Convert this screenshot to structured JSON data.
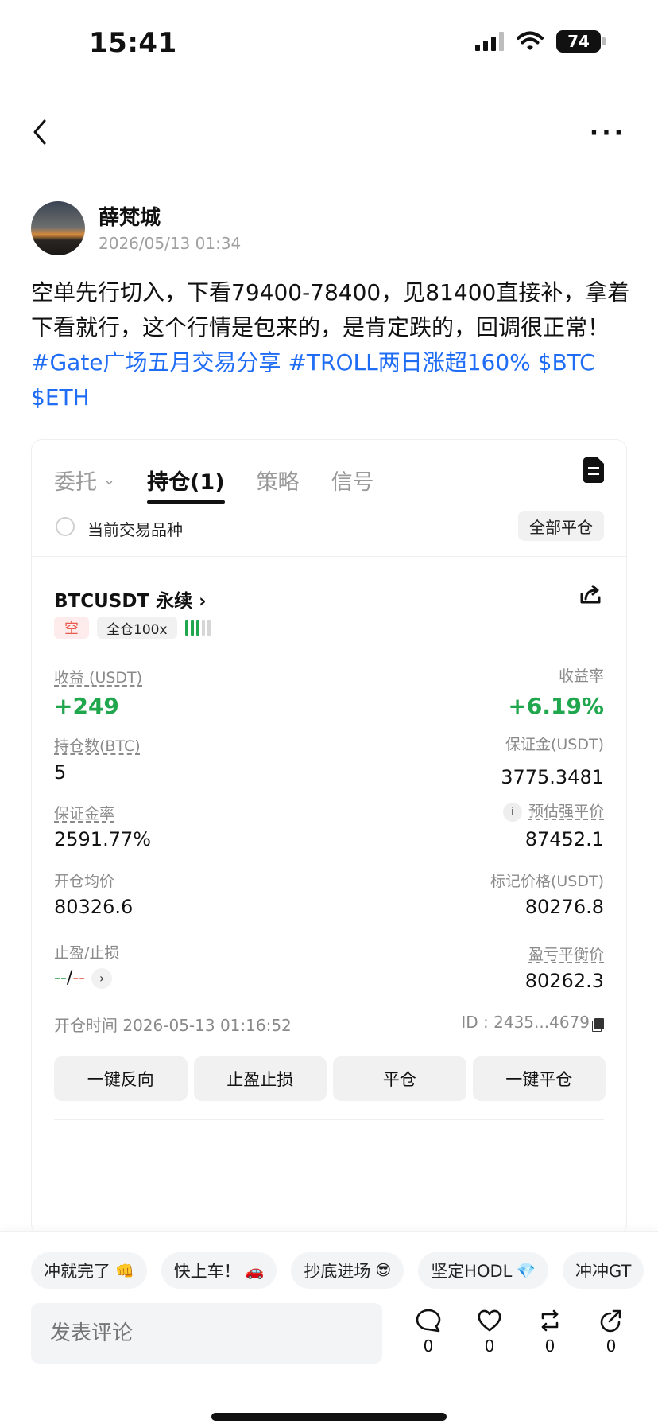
{
  "status_bar": {
    "time": "15:41",
    "battery": "74"
  },
  "nav": {
    "more": "···"
  },
  "post": {
    "author": "薛梵城",
    "timestamp": "2026/05/13 01:34",
    "text": "空单先行切入，下看79400-78400，见81400直接补，拿着下看就行，这个行情是包来的，是肯定跌的，回调很正常！",
    "tags": [
      "#Gate广场五月交易分享",
      "#TROLL两日涨超160%",
      "$BTC",
      "$ETH"
    ]
  },
  "card": {
    "tabs": [
      {
        "label": "委托"
      },
      {
        "label": "持仓(1)"
      },
      {
        "label": "策略"
      },
      {
        "label": "信号"
      }
    ],
    "filter_label": "当前交易品种",
    "close_all_label": "全部平仓",
    "position": {
      "symbol": "BTCUSDT 永续",
      "side": "空",
      "leverage": "全仓100x",
      "pnl_label": "收益 (USDT)",
      "pnl_value": "+249",
      "roe_label": "收益率",
      "roe_value": "+6.19%",
      "size_label": "持仓数(BTC)",
      "size_value": "5",
      "margin_label": "保证金(USDT)",
      "margin_value": "3775.3481",
      "margin_ratio_label": "保证金率",
      "margin_ratio_value": "2591.77%",
      "liq_label": "预估强平价",
      "liq_value": "87452.1",
      "entry_label": "开仓均价",
      "entry_value": "80326.6",
      "mark_label": "标记价格(USDT)",
      "mark_value": "80276.8",
      "tpsl_label": "止盈/止损",
      "tp_value": "--",
      "tpsl_sep": "/",
      "sl_value": "--",
      "breakeven_label": "盈亏平衡价",
      "breakeven_value": "80262.3",
      "open_time": "开仓时间 2026-05-13 01:16:52",
      "id": "ID : 2435...4679"
    },
    "actions": [
      "一键反向",
      "止盈止损",
      "平仓",
      "一键平仓"
    ]
  },
  "reactions": [
    {
      "text": "冲就完了",
      "emoji": "👊"
    },
    {
      "text": "快上车！",
      "emoji": "🚗"
    },
    {
      "text": "抄底进场",
      "emoji": "😎"
    },
    {
      "text": "坚定HODL",
      "emoji": "💎"
    },
    {
      "text": "冲冲GT",
      "emoji": ""
    }
  ],
  "comment": {
    "placeholder": "发表评论"
  },
  "stats": {
    "comments": "0",
    "likes": "0",
    "reposts": "0",
    "shares": "0"
  },
  "colors": {
    "up": "#20a64c",
    "down": "#e85a4f",
    "link": "#1f6cf5"
  }
}
